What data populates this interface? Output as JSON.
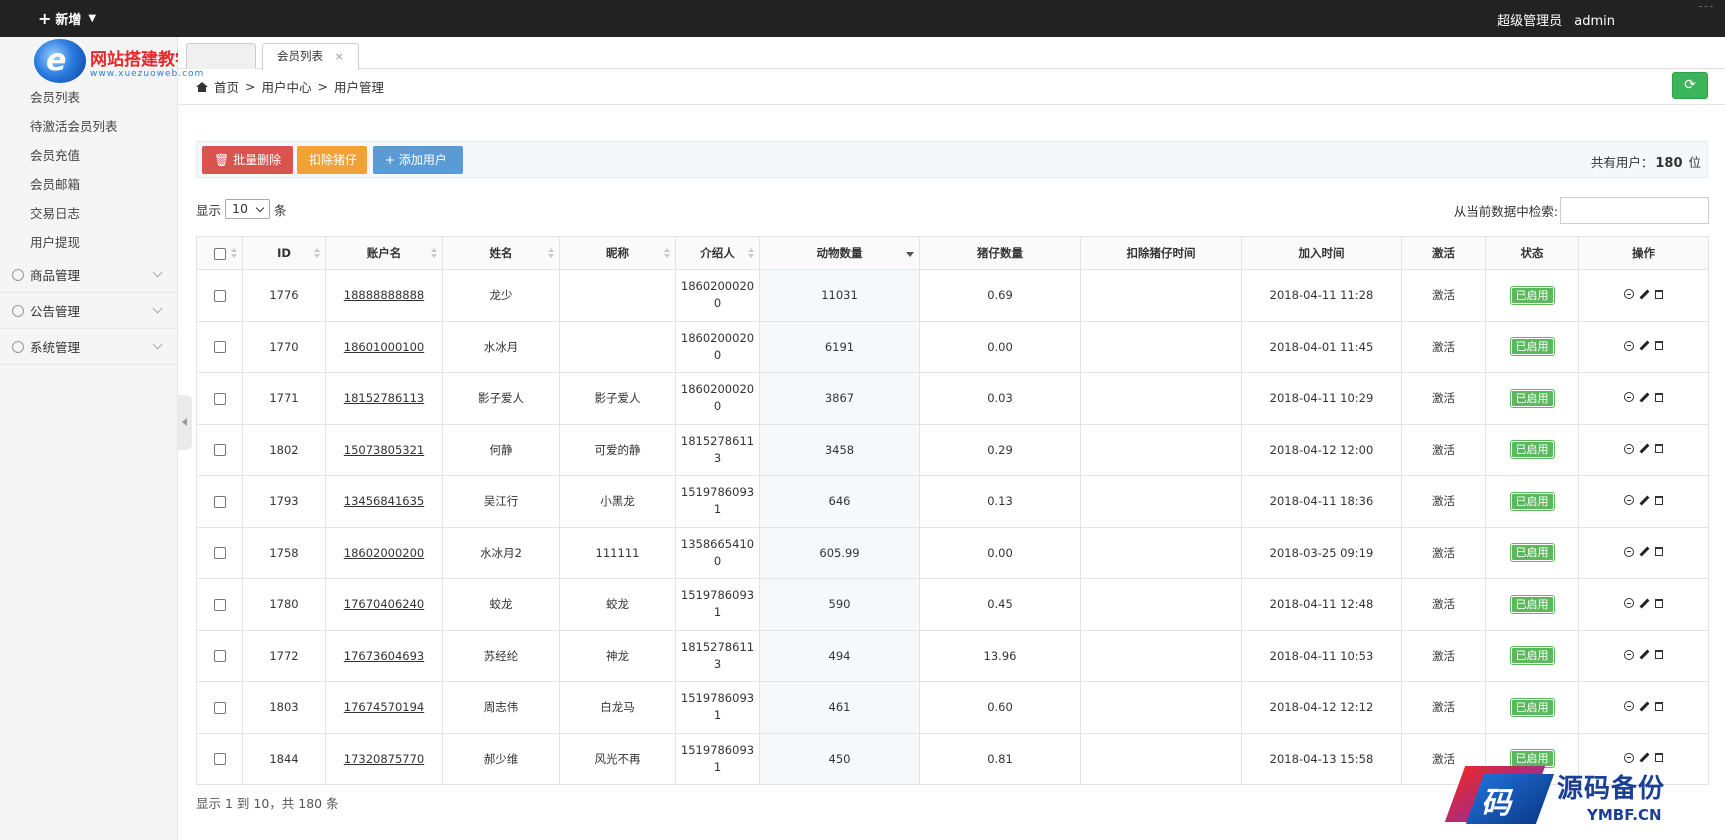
{
  "topbar": {
    "new_label": "新增",
    "user_role": "超级管理员",
    "user_name": "admin"
  },
  "logo": {
    "text": "网站搭建教学网",
    "url": "www.xuezuoweb.com"
  },
  "sidebar": {
    "items": [
      {
        "label": "会员列表"
      },
      {
        "label": "待激活会员列表"
      },
      {
        "label": "会员充值"
      },
      {
        "label": "会员邮箱"
      },
      {
        "label": "交易日志"
      },
      {
        "label": "用户提现"
      }
    ],
    "groups": [
      {
        "label": "商品管理"
      },
      {
        "label": "公告管理"
      },
      {
        "label": "系统管理"
      }
    ]
  },
  "tabs": [
    {
      "label": ""
    },
    {
      "label": "会员列表",
      "close": "×"
    }
  ],
  "breadcrumb": {
    "home": "首页",
    "sep": ">",
    "level1": "用户中心",
    "level2": "用户管理"
  },
  "refresh_icon": "⟳",
  "toolbar": {
    "batch_delete": "批量删除",
    "deduct_piglet": "扣除猪仔",
    "add_user": "添加用户",
    "total_label": "共有用户：",
    "total_count": "180",
    "total_unit": "位"
  },
  "length": {
    "prefix": "显示",
    "value": "10",
    "suffix": "条"
  },
  "search": {
    "label": "从当前数据中检索:"
  },
  "table": {
    "headers": [
      "ID",
      "账户名",
      "姓名",
      "昵称",
      "介绍人",
      "动物数量",
      "猪仔数量",
      "扣除猪仔时间",
      "加入时间",
      "激活",
      "状态",
      "操作"
    ],
    "rows": [
      {
        "id": "1776",
        "account": "18888888888",
        "name": "龙少",
        "nick": "",
        "ref": "18602000200",
        "animals": "11031",
        "piglets": "0.69",
        "deduct_time": "",
        "joined": "2018-04-11 11:28",
        "active": "激活",
        "status": "已启用"
      },
      {
        "id": "1770",
        "account": "18601000100",
        "name": "水冰月",
        "nick": "",
        "ref": "18602000200",
        "animals": "6191",
        "piglets": "0.00",
        "deduct_time": "",
        "joined": "2018-04-01 11:45",
        "active": "激活",
        "status": "已启用"
      },
      {
        "id": "1771",
        "account": "18152786113",
        "name": "影子爱人",
        "nick": "影子爱人",
        "ref": "18602000200",
        "animals": "3867",
        "piglets": "0.03",
        "deduct_time": "",
        "joined": "2018-04-11 10:29",
        "active": "激活",
        "status": "已启用"
      },
      {
        "id": "1802",
        "account": "15073805321",
        "name": "何静",
        "nick": "可爱的静",
        "ref": "18152786113",
        "animals": "3458",
        "piglets": "0.29",
        "deduct_time": "",
        "joined": "2018-04-12 12:00",
        "active": "激活",
        "status": "已启用"
      },
      {
        "id": "1793",
        "account": "13456841635",
        "name": "吴江行",
        "nick": "小黑龙",
        "ref": "15197860931",
        "animals": "646",
        "piglets": "0.13",
        "deduct_time": "",
        "joined": "2018-04-11 18:36",
        "active": "激活",
        "status": "已启用"
      },
      {
        "id": "1758",
        "account": "18602000200",
        "name": "水冰月2",
        "nick": "111111",
        "ref": "13586654100",
        "animals": "605.99",
        "piglets": "0.00",
        "deduct_time": "",
        "joined": "2018-03-25 09:19",
        "active": "激活",
        "status": "已启用"
      },
      {
        "id": "1780",
        "account": "17670406240",
        "name": "蛟龙",
        "nick": "蛟龙",
        "ref": "15197860931",
        "animals": "590",
        "piglets": "0.45",
        "deduct_time": "",
        "joined": "2018-04-11 12:48",
        "active": "激活",
        "status": "已启用"
      },
      {
        "id": "1772",
        "account": "17673604693",
        "name": "苏经纶",
        "nick": "神龙",
        "ref": "18152786113",
        "animals": "494",
        "piglets": "13.96",
        "deduct_time": "",
        "joined": "2018-04-11 10:53",
        "active": "激活",
        "status": "已启用"
      },
      {
        "id": "1803",
        "account": "17674570194",
        "name": "周志伟",
        "nick": "白龙马",
        "ref": "15197860931",
        "animals": "461",
        "piglets": "0.60",
        "deduct_time": "",
        "joined": "2018-04-12 12:12",
        "active": "激活",
        "status": "已启用"
      },
      {
        "id": "1844",
        "account": "17320875770",
        "name": "郝少维",
        "nick": "风光不再",
        "ref": "15197860931",
        "animals": "450",
        "piglets": "0.81",
        "deduct_time": "",
        "joined": "2018-04-13 15:58",
        "active": "激活",
        "status": "已启用"
      }
    ]
  },
  "info": {
    "text": "显示 1 到 10，共 180 条"
  },
  "watermark": {
    "glyph": "码",
    "title": "源码备份",
    "url": "YMBF.CN"
  },
  "colors": {
    "topbar": "#222222",
    "danger": "#d9534f",
    "warning": "#f0a236",
    "primary": "#5b9bd5",
    "success": "#5cb85c",
    "refresh": "#3cb55a"
  }
}
